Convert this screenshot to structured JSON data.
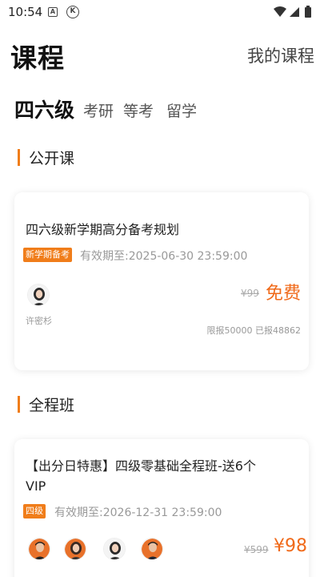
{
  "status_bar": {
    "time": "10:54",
    "badge_a": "A",
    "badge_k": "K",
    "icons": [
      "wifi-icon",
      "signal-icon",
      "battery-icon"
    ]
  },
  "header": {
    "title": "课程",
    "my_courses": "我的课程"
  },
  "tabs": [
    {
      "label": "四六级",
      "active": true
    },
    {
      "label": "考研",
      "active": false
    },
    {
      "label": "等考",
      "active": false
    },
    {
      "label": "留学",
      "active": false
    }
  ],
  "sections": {
    "public": "公开课",
    "full": "全程班"
  },
  "public_card": {
    "title": "四六级新学期高分备考规划",
    "tag": "新学期备考",
    "expiry": "有效期至:2025-06-30 23:59:00",
    "teacher": "许密杉",
    "original_price": "¥99",
    "price": "免费",
    "stats": "限报50000   已报48862"
  },
  "full_card": {
    "title_line1": "【出分日特惠】四级零基础全程班-送6个",
    "title_line2": "VIP",
    "tag": "四级",
    "expiry": "有效期至:2026-12-31 23:59:00",
    "original_price": "¥599",
    "price": "¥98"
  },
  "colors": {
    "accent": "#f07d1a",
    "price": "#f06a1a"
  }
}
